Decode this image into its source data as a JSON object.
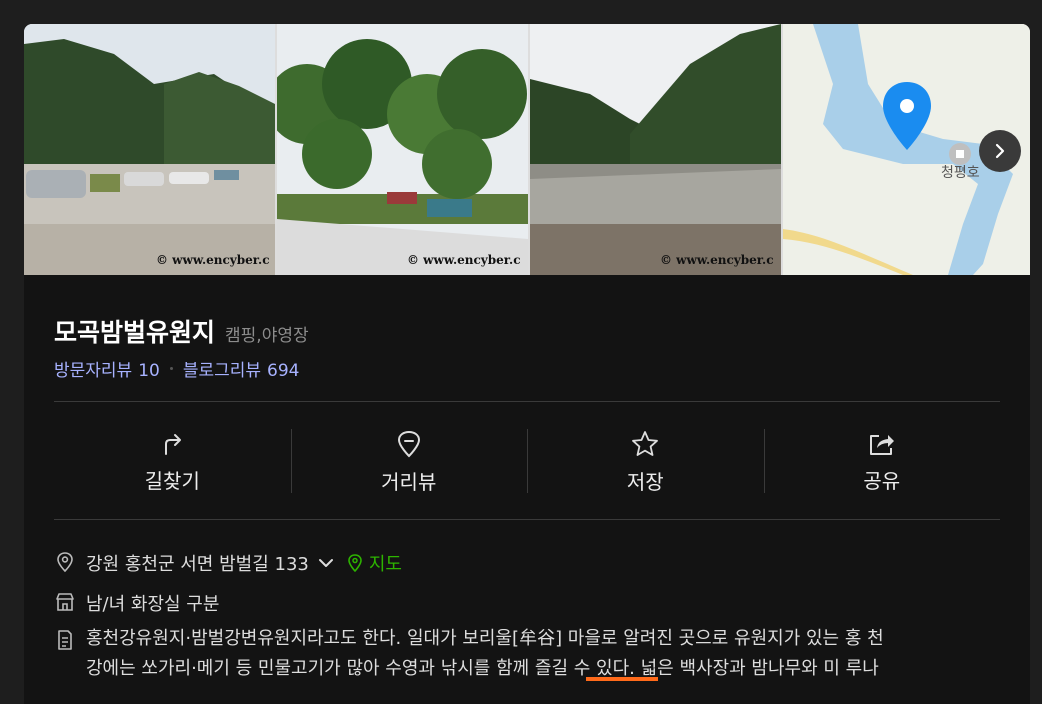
{
  "place": {
    "name": "모곡밤벌유원지",
    "category": "캠핑,야영장"
  },
  "reviews": {
    "visitor_label": "방문자리뷰",
    "visitor_count": "10",
    "blog_label": "블로그리뷰",
    "blog_count": "694"
  },
  "photos": {
    "watermark": "© www.encyber.c",
    "map_label": "청평호"
  },
  "actions": [
    {
      "label": "길찾기",
      "icon": "directions-icon"
    },
    {
      "label": "거리뷰",
      "icon": "street-view-icon"
    },
    {
      "label": "저장",
      "icon": "star-icon"
    },
    {
      "label": "공유",
      "icon": "share-icon"
    }
  ],
  "info": {
    "address": "강원 홍천군 서면 밤벌길 133",
    "map_link": "지도",
    "restroom": "남/녀 화장실 구분",
    "description_line1": "홍천강유원지·밤벌강변유원지라고도 한다. 일대가 보리울[牟谷] 마을로 알려진 곳으로 유원지가 있는 홍 천",
    "description_line2": "강에는 쏘가리·메기 등 민물고기가 많아 수영과 낚시를 함께 즐길 수 있다. 넓은 백사장과 밤나무와 미 루나"
  },
  "colors": {
    "accent_link": "#a7b2ff",
    "map_green": "#2db400",
    "background": "#131313"
  }
}
